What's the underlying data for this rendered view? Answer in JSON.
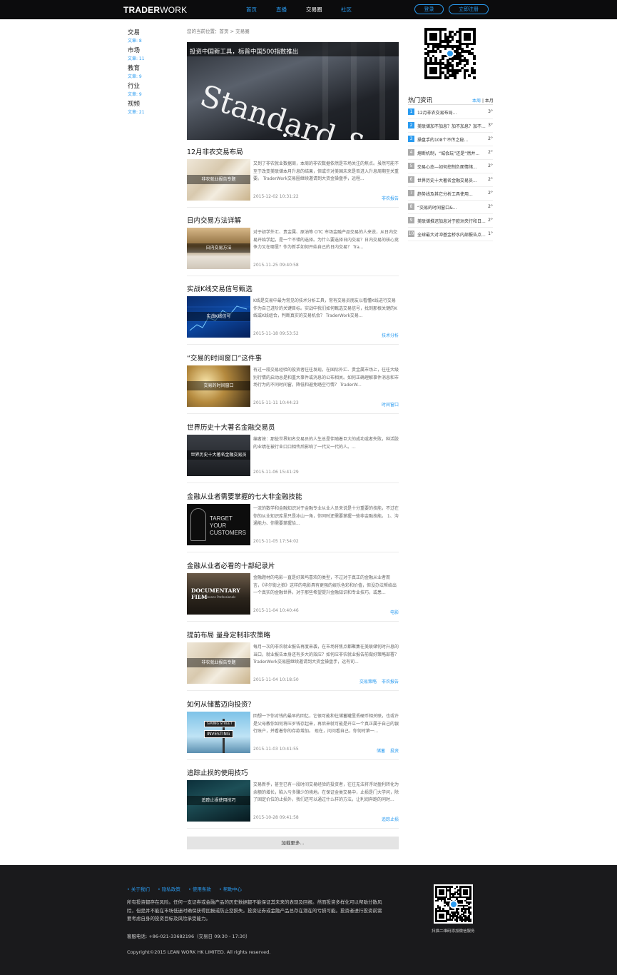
{
  "header": {
    "logo_bold": "TRADER",
    "logo_rest": "WORK",
    "nav": [
      "首页",
      "直播",
      "交易圈",
      "社区"
    ],
    "login": "登录",
    "register": "立即注册"
  },
  "sidebar": {
    "categories": [
      {
        "name": "交易",
        "count": "文章: 8"
      },
      {
        "name": "市场",
        "count": "文章: 11"
      },
      {
        "name": "教育",
        "count": "文章: 9"
      },
      {
        "name": "行业",
        "count": "文章: 9"
      },
      {
        "name": "视频",
        "count": "文章: 21"
      }
    ]
  },
  "breadcrumb": "您的当前位置：首页 > 交易圈",
  "hero": {
    "title": "投资中国新工具，标普中国500指数推出",
    "image_text": "Standard & Po"
  },
  "articles": [
    {
      "title": "12月非农交易布局",
      "caption": "非农就业报告专题",
      "desc": "又到了非农就业数据周，本周的非农数据依然是市场关注的焦点。虽然可能不至于改变美联储本月升息的结果，但或许对美国未来是否进入升息周期至关重要。 TraderWork交易圈继续邀请到大资金操盘手，远程...",
      "date": "2015-12-02 10:31:22",
      "tags": [
        "非农报告"
      ],
      "img": "paper"
    },
    {
      "title": "日内交易方法详解",
      "caption": "日内交易方法",
      "desc": "对于初学外汇、贵金属、原油等 OTC 市场金融产品交易的人来说，从日内交易开始学起，是一个不错的选择。为什么要选择日内交易？日内交易的核心竞争力又在哪里？作为新手如何开始自己的日内交易？ Tra...",
      "date": "2015-11-25 09:40:58",
      "tags": [],
      "img": "coins"
    },
    {
      "title": "实战K线交易信号甄选",
      "caption": "实战K线信号",
      "desc": "K线是交易中最为常见的技术分析工具，常有交易员朋友以看懂K线进行交易作为自己进阶的关键目标。实战中我们如何甄选交易信号，找到那根关键的K线或K线组合，判断真实的交易机会？ TraderWork交易...",
      "date": "2015-11-18 09:53:52",
      "tags": [
        "技术分析"
      ],
      "img": "chart"
    },
    {
      "title": "“交易的时间窗口”这件事",
      "caption": "交易的时间窗口",
      "desc": "有过一段交易经验的投资者往往发现，在国际外汇、贵金属市场上，往往大级别行情的启动总是和重大事件或消息的公布相关。如何正确理解事件消息和市场行为的不同时间窗，降低和避免踏空行情？ TraderW...",
      "date": "2015-11-11 10:44:23",
      "tags": [
        "时间窗口"
      ],
      "img": "watch"
    },
    {
      "title": "世界历史十大著名金融交易员",
      "caption": "世界历史十大著名金融交易员",
      "desc": "编者按：那些世界知名交易员的人生总是伴随着巨大的成功或者失败，种活胶的业绩在被行业口口相传后影响了一代又一代的人。...",
      "date": "2015-11-06 15:41:29",
      "tags": [],
      "img": "famous"
    },
    {
      "title": "金融从业者需要掌握的七大非金融技能",
      "caption": "",
      "desc": "一流的数学和金融知识对于金融专业从业人员来说是十分重要的技能，不过在你的从业知识库里只是冰山一角，你同时还需要掌握一些非金融技能。 1、沟通能力、你需要掌握恰...",
      "date": "2015-11-05 17:54:02",
      "tags": [],
      "img": "target",
      "img_text": [
        "TARGET",
        "YOUR",
        "CUSTOMERS"
      ]
    },
    {
      "title": "金融从业者必看的十部纪录片",
      "caption": "",
      "desc": "金融题材的电影一直是好莱坞喜欢的类型，不过对于真正的金融从业者而言，《华尔街之狼》这样的电影具有更强的娱乐色彩和价值，但没办法帮给出一个真实的金融世界。对于那些希望提升金融知识和专业技巧，或患...",
      "date": "2015-11-04 10:40:46",
      "tags": [
        "电影"
      ],
      "img": "film",
      "img_text": [
        "DOCUMENTARY FILM",
        "For Finance Professionals"
      ]
    },
    {
      "title": "提前布局 量身定制非农策略",
      "caption": "非农就业报告专题",
      "desc": "每月一次的非农就业报告再度来袭，在市场将焦点都聚集在美联储何时升息的当口，就业报告本身还有多大的效应？如何应非农就业报告前做好策略部署？ TraderWork交易圈继续邀请到大资金操盘手，远有司...",
      "date": "2015-11-04 10:18:50",
      "tags": [
        "交易策略",
        "非农报告"
      ],
      "img": "paper"
    },
    {
      "title": "如何从储蓄迈向投资？",
      "caption": "",
      "desc": "回想一下你对钱的最早的回忆，它很可能和往储蓄罐里丢硬币相关联，也或许是父母教你如何将压岁钱存起来，再后来就可能是开立一个真正属于自己的银行账户，并看着你的存款增加。 现在，问问看自己，你何时第一...",
      "date": "2015-11-03 10:41:55",
      "tags": [
        "储蓄",
        "投资"
      ],
      "img": "street",
      "img_text": [
        "SAVING STREET",
        "INVESTING"
      ]
    },
    {
      "title": "追踪止损的使用技巧",
      "caption": "追踪止损使用技巧",
      "desc": "交易新手，甚至已有一段时间交易经验的投资者，往往无法将浮动盈利转化为余额的增长，陷入亏多赚少的境地。在保证金类交易中，止损是门大学问，除了固定价位的止损外，我们还可以通过什么样的方法，让利润奔跑的同时...",
      "date": "2015-10-28 09:41:58",
      "tags": [
        "追踪止损"
      ],
      "img": "city"
    }
  ],
  "load_more": "加载更多...",
  "hot": {
    "title": "热门资讯",
    "tab_week": "本周",
    "tab_divider": "|",
    "tab_month": "本月",
    "items": [
      {
        "no": "1",
        "title": "12月非农交易布局...",
        "count": "3°"
      },
      {
        "no": "2",
        "title": "美联储加不加息？加不加息？加不...",
        "count": "3°"
      },
      {
        "no": "3",
        "title": "操盘手的108个不传之秘...",
        "count": "2°"
      },
      {
        "no": "4",
        "title": "熔断机制，“城会玩”还是“然并...",
        "count": "2°"
      },
      {
        "no": "5",
        "title": "交易心态—如何控制负面情绪...",
        "count": "2°"
      },
      {
        "no": "6",
        "title": "世界历史十大著名金融交易员...",
        "count": "2°"
      },
      {
        "no": "7",
        "title": "趋势线及其它分析工具使用...",
        "count": "2°"
      },
      {
        "no": "8",
        "title": "“交易的时间窗口&...",
        "count": "2°"
      },
      {
        "no": "9",
        "title": "美联储推迟加息对于欧洲央行和日...",
        "count": "2°"
      },
      {
        "no": "10",
        "title": "全球最大对冲基金桥水内部报告点...",
        "count": "1°"
      }
    ]
  },
  "footer": {
    "links": [
      "• 关于我们",
      "• 隐私政策",
      "• 使用条款",
      "• 帮助中心"
    ],
    "disclaimer": "所有投资都存在风险。任何一支证券或金融产品的历史数据都不能保证其未来的表现及回报。然而投资多样化可以帮助分散风险，但是并不能在市场低迷时确保获得回报或防止您损失。投资证券或金融产品总存在潜在的亏损可能。投资者进行投资前需要考虑自身的投资目标及风险承受能力。",
    "phone": "客服电话: +86-021-33682196（交易日 09:30 - 17:30）",
    "copyright": "Copyright©2015 LEAN WORK HK LIMITED. All rights reserved.",
    "qr_caption": "扫描二维码添加微信服务"
  },
  "colors": {
    "accent": "#2a9bf0",
    "topbar": "#0c0c0d",
    "footer": "#1a1a1c"
  }
}
